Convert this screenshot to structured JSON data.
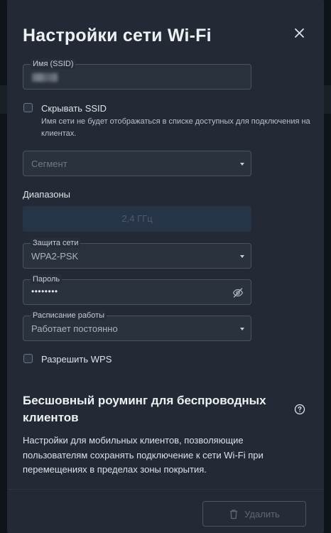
{
  "modal": {
    "title": "Настройки сети Wi-Fi"
  },
  "ssid": {
    "label": "Имя (SSID)"
  },
  "hide_ssid": {
    "label": "Скрывать SSID",
    "hint": "Имя сети не будет отображаться в списке доступных для подключения на клиентах.",
    "checked": false
  },
  "segment": {
    "placeholder": "Сегмент"
  },
  "bands": {
    "label": "Диапазоны",
    "button": "2,4 ГГц"
  },
  "security": {
    "label": "Защита сети",
    "value": "WPA2-PSK"
  },
  "password": {
    "label": "Пароль",
    "value": "••••••••"
  },
  "schedule": {
    "label": "Расписание работы",
    "value": "Работает постоянно"
  },
  "wps": {
    "label": "Разрешить WPS",
    "checked": false
  },
  "roaming": {
    "title": "Бесшовный роуминг для беспроводных клиентов",
    "description": "Настройки для мобильных клиентов, позволяющие пользователям сохранять подключение к сети Wi-Fi при перемещениях в пределах зоны покрытия."
  },
  "footer": {
    "delete_label": "Удалить"
  },
  "icons": {
    "close": "close-icon",
    "dropdown": "chevron-down-icon",
    "eye": "eye-off-icon",
    "help": "help-circle-icon",
    "trash": "trash-icon"
  },
  "colors": {
    "modal_bg": "#232a35",
    "field_border": "#4a5361",
    "band_bg": "#263447"
  }
}
